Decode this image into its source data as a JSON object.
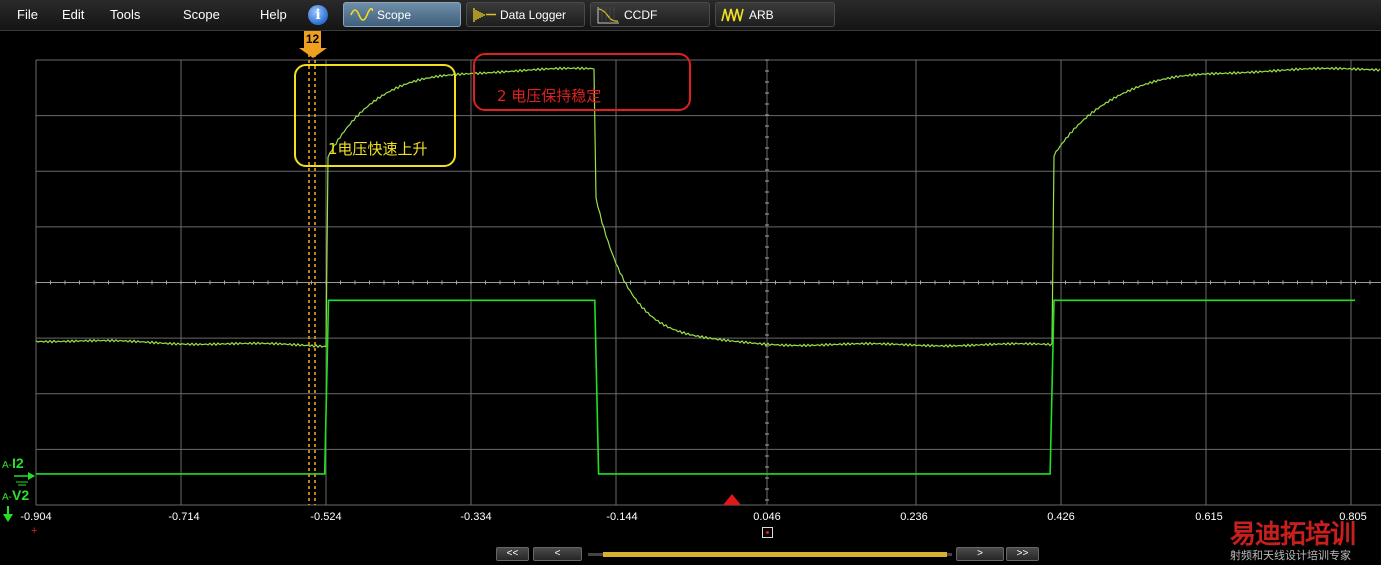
{
  "menu": {
    "file": "File",
    "edit": "Edit",
    "tools": "Tools",
    "scope": "Scope",
    "help": "Help",
    "info": "i"
  },
  "tabs": [
    {
      "label": "Scope",
      "icon": "sine-wave-icon",
      "active": true
    },
    {
      "label": "Data Logger",
      "icon": "data-logger-icon",
      "active": false
    },
    {
      "label": "CCDF",
      "icon": "ccdf-icon",
      "active": false
    },
    {
      "label": "ARB",
      "icon": "arb-wave-icon",
      "active": false
    }
  ],
  "xaxis": {
    "ticks": [
      "-0.904",
      "-0.714",
      "-0.524",
      "-0.334",
      "-0.144",
      "0.046",
      "0.236",
      "0.426",
      "0.615",
      "0.805"
    ]
  },
  "channels": {
    "i2": {
      "prefix": "A-",
      "name": "I2"
    },
    "v2": {
      "prefix": "A-",
      "name": "V2"
    }
  },
  "marker": {
    "label": "12"
  },
  "annotations": {
    "rise": "1电压快速上升",
    "hold": "2  电压保持稳定"
  },
  "navigation": {
    "first": "<<",
    "prev": "<",
    "next": ">",
    "last": ">>"
  },
  "watermark": {
    "title": "易迪拓培训",
    "subtitle": "射频和天线设计培训专家"
  },
  "colors": {
    "trace": "#9ae04a",
    "current_trace": "#22e022",
    "annotation_yellow": "#f0e020",
    "annotation_red": "#e02020",
    "marker": "#f0a020"
  },
  "chart_data": {
    "type": "line",
    "xlim": [
      -0.904,
      0.805
    ],
    "series": [
      {
        "name": "V2",
        "x": [
          -0.904,
          -0.53,
          -0.525,
          -0.45,
          -0.3,
          -0.18,
          -0.175,
          -0.1,
          0.0,
          0.2,
          0.41,
          0.415,
          0.5,
          0.805
        ],
        "y": [
          0.37,
          0.36,
          0.78,
          0.92,
          0.97,
          0.98,
          0.68,
          0.45,
          0.38,
          0.36,
          0.36,
          0.78,
          0.92,
          0.98
        ]
      },
      {
        "name": "I2",
        "x": [
          -0.904,
          -0.53,
          -0.525,
          -0.18,
          -0.175,
          0.41,
          0.415,
          0.805
        ],
        "y": [
          0.07,
          0.07,
          0.46,
          0.46,
          0.07,
          0.07,
          0.46,
          0.46
        ]
      }
    ]
  }
}
